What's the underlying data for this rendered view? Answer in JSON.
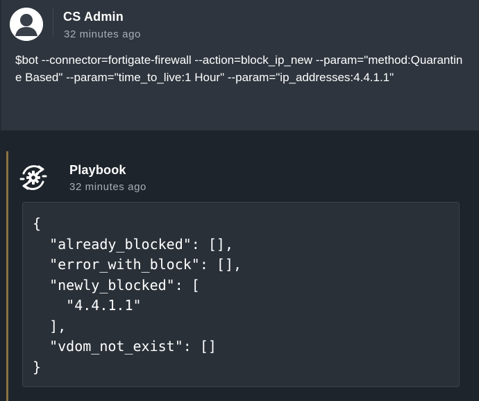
{
  "messages": [
    {
      "author": "CS Admin",
      "time": "32 minutes ago",
      "avatar_icon": "user-avatar-icon",
      "text": "$bot --connector=fortigate-firewall --action=block_ip_new --param=\"method:Quarantine Based\" --param=\"time_to_live:1 Hour\" --param=\"ip_addresses:4.4.1.1\""
    },
    {
      "author": "Playbook",
      "time": "32 minutes ago",
      "avatar_icon": "playbook-gear-cycle-icon",
      "code": "{\n  \"already_blocked\": [],\n  \"error_with_block\": [],\n  \"newly_blocked\": [\n    \"4.4.1.1\"\n  ],\n  \"vdom_not_exist\": []\n}"
    }
  ],
  "colors": {
    "page_background": "#1a1f26",
    "user_message_background": "#2e353e",
    "bot_message_background": "#1e242b",
    "code_background": "#2a3038",
    "accent_bar": "#8a7440",
    "muted_text": "#a7aeb7"
  }
}
